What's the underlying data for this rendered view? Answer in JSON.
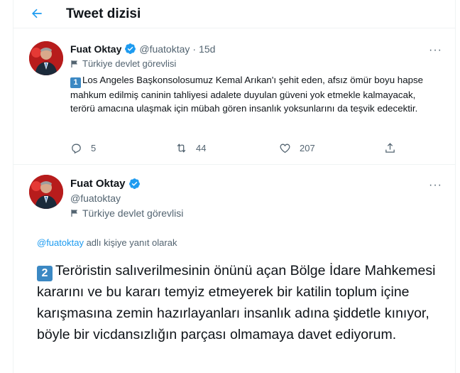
{
  "header": {
    "title": "Tweet dizisi",
    "back_icon": "arrow-left-icon"
  },
  "colors": {
    "accent": "#1d9bf0",
    "text": "#0f1419",
    "secondary": "#536471",
    "badge": "#3b88c3"
  },
  "tweet1": {
    "name": "Fuat Oktay",
    "handle": "@fuatoktay",
    "separator": "·",
    "time": "15d",
    "more": "···",
    "gov_label": "Türkiye devlet görevlisi",
    "number": "1",
    "text": "Los Angeles Başkonsolosumuz Kemal Arıkan'ı şehit eden, afsız ömür boyu hapse mahkum edilmiş caninin tahliyesi adalete duyulan güveni yok etmekle kalmayacak, terörü amacına ulaşmak için mübah gören insanlık yoksunlarını da teşvik edecektir.",
    "replies": "5",
    "retweets": "44",
    "likes": "207"
  },
  "tweet2": {
    "name": "Fuat Oktay",
    "handle": "@fuatoktay",
    "more": "···",
    "gov_label": "Türkiye devlet görevlisi",
    "reply_mention": "@fuatoktay",
    "reply_suffix": " adlı kişiye yanıt olarak",
    "number": "2",
    "text": "Teröristin salıverilmesinin önünü açan Bölge İdare Mahkemesi kararını ve bu kararı temyiz etmeyerek bir katilin toplum içine karışmasına zemin hazırlayanları insanlık adına şiddetle kınıyor, böyle bir vicdansızlığın parçası olmamaya davet ediyorum."
  }
}
